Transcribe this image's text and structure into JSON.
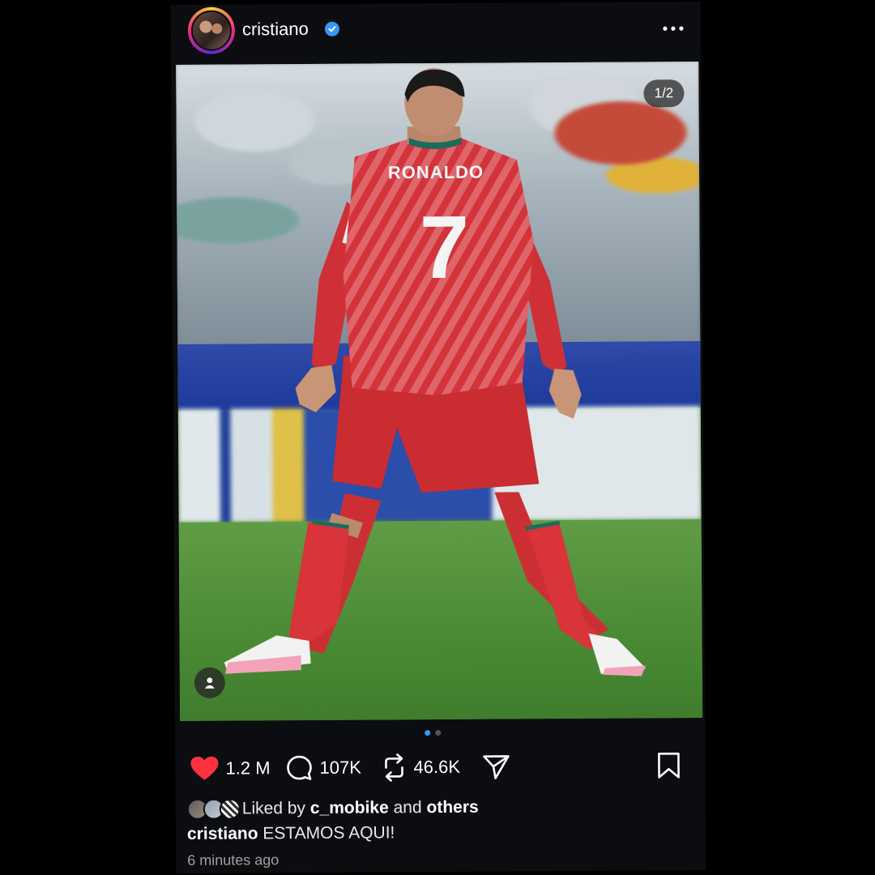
{
  "post": {
    "username": "cristiano",
    "verified": true,
    "more_icon": "more-horizontal-icon",
    "image_counter": "1/2",
    "carousel": {
      "total": 2,
      "active": 1
    },
    "jersey_name": "RONALDO",
    "jersey_number": "7"
  },
  "actions": {
    "likes": "1.2 M",
    "comments": "107K",
    "reposts": "46.6K",
    "like_color": "#ff3040"
  },
  "liked_by": {
    "prefix": "Liked by",
    "user": "c_mobike",
    "conjunction": "and",
    "others": "others"
  },
  "caption": {
    "username": "cristiano",
    "text": "ESTAMOS AQUI!"
  },
  "timestamp": "6 minutes ago",
  "colors": {
    "background": "#0b0d10",
    "accent": "#3897f0",
    "kit_red": "#d12f35"
  }
}
